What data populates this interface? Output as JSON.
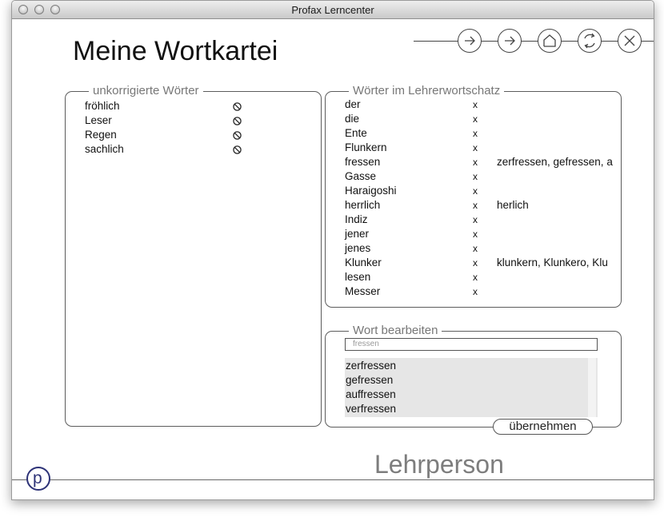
{
  "window": {
    "title": "Profax Lerncenter"
  },
  "page": {
    "heading": "Meine Wortkartei",
    "role": "Lehrperson",
    "logo_letter": "p"
  },
  "nav": {
    "icons": [
      "forward-arrow-icon",
      "forward-arrow-icon",
      "home-icon",
      "refresh-icon",
      "close-icon"
    ]
  },
  "uncorrected": {
    "legend": "unkorrigierte Wörter",
    "words": [
      "fröhlich",
      "Leser",
      "Regen",
      "sachlich"
    ],
    "status_icon": "blocked-icon"
  },
  "vocabulary": {
    "legend": "Wörter im Lehrerwortschatz",
    "rows": [
      {
        "word": "der",
        "mark": "x",
        "variants": ""
      },
      {
        "word": "die",
        "mark": "x",
        "variants": ""
      },
      {
        "word": "Ente",
        "mark": "x",
        "variants": ""
      },
      {
        "word": "Flunkern",
        "mark": "x",
        "variants": ""
      },
      {
        "word": "fressen",
        "mark": "x",
        "variants": "zerfressen, gefressen, au"
      },
      {
        "word": "Gasse",
        "mark": "x",
        "variants": ""
      },
      {
        "word": "Haraigoshi",
        "mark": "x",
        "variants": ""
      },
      {
        "word": "herrlich",
        "mark": "x",
        "variants": "herlich"
      },
      {
        "word": "Indiz",
        "mark": "x",
        "variants": ""
      },
      {
        "word": "jener",
        "mark": "x",
        "variants": ""
      },
      {
        "word": "jenes",
        "mark": "x",
        "variants": ""
      },
      {
        "word": "Klunker",
        "mark": "x",
        "variants": "klunkern, Klunkero, Klu"
      },
      {
        "word": "lesen",
        "mark": "x",
        "variants": ""
      },
      {
        "word": "Messer",
        "mark": "x",
        "variants": ""
      }
    ]
  },
  "edit": {
    "legend": "Wort bearbeiten",
    "input_value": "fressen",
    "variants": [
      "zerfressen",
      "gefressen",
      "auffressen",
      "verfressen"
    ],
    "apply_label": "übernehmen"
  }
}
